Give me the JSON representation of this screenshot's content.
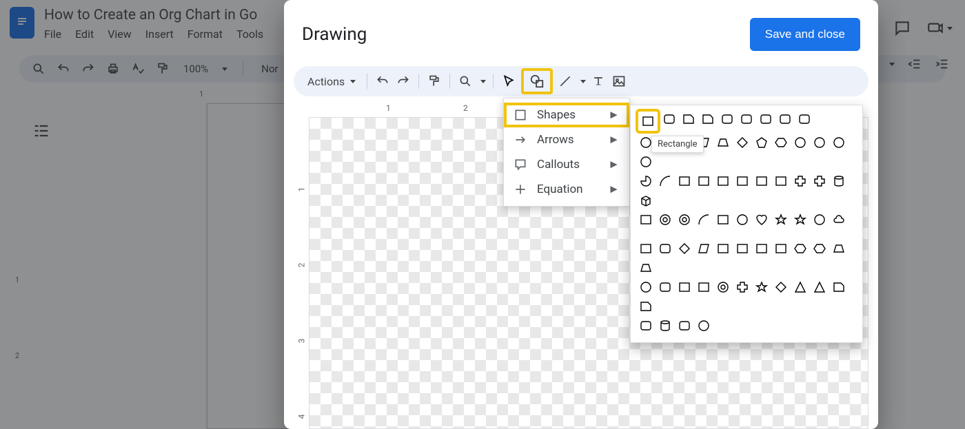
{
  "docs": {
    "title": "How to Create an Org Chart in Go",
    "menus": [
      "File",
      "Edit",
      "View",
      "Insert",
      "Format",
      "Tools"
    ],
    "zoom": "100%",
    "style_name": "Nor",
    "ruler_h_start_label": "1",
    "ruler_v_labels": [
      "1",
      "2"
    ]
  },
  "dialog": {
    "title": "Drawing",
    "save_label": "Save and close",
    "actions_label": "Actions",
    "ruler_h_labels": [
      "1",
      "2"
    ],
    "ruler_v_labels": [
      "1",
      "2",
      "3",
      "4"
    ]
  },
  "shape_menu": {
    "items": [
      {
        "icon": "square-icon",
        "label": "Shapes"
      },
      {
        "icon": "arrow-icon",
        "label": "Arrows"
      },
      {
        "icon": "callout-icon",
        "label": "Callouts"
      },
      {
        "icon": "plus-icon",
        "label": "Equation"
      }
    ]
  },
  "tooltip": "Rectangle"
}
